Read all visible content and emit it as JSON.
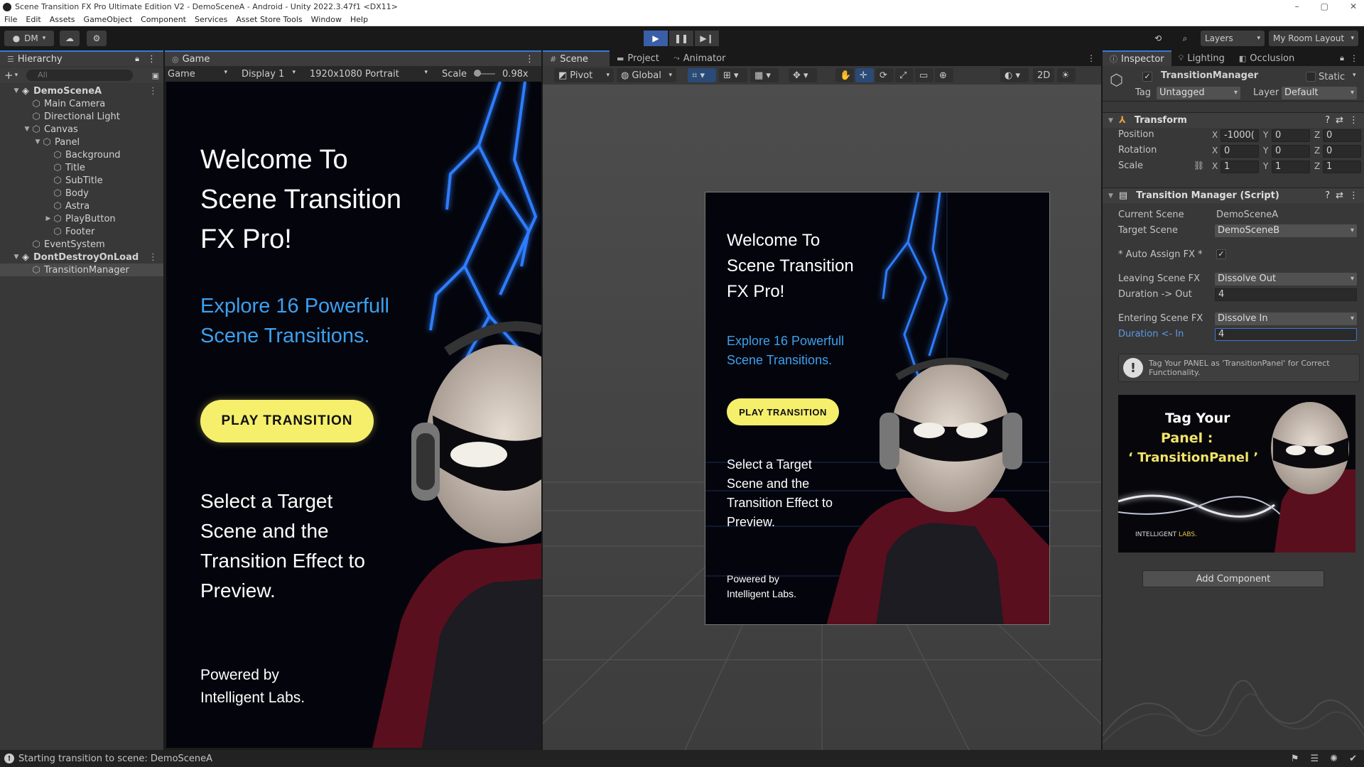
{
  "window": {
    "title": "Scene Transition FX Pro Ultimate Edition V2 - DemoSceneA - Android - Unity 2022.3.47f1 <DX11>"
  },
  "menu": [
    "File",
    "Edit",
    "Assets",
    "GameObject",
    "Component",
    "Services",
    "Asset Store Tools",
    "Window",
    "Help"
  ],
  "toolbar": {
    "account": "DM",
    "layers": "Layers",
    "layout": "My Room Layout"
  },
  "hierarchy": {
    "tab": "Hierarchy",
    "search_placeholder": "All",
    "rows": [
      {
        "label": "DemoSceneA",
        "depth": 0,
        "expanded": true,
        "scene": true
      },
      {
        "label": "Main Camera",
        "depth": 1
      },
      {
        "label": "Directional Light",
        "depth": 1
      },
      {
        "label": "Canvas",
        "depth": 1,
        "expanded": true
      },
      {
        "label": "Panel",
        "depth": 2,
        "expanded": true
      },
      {
        "label": "Background",
        "depth": 3
      },
      {
        "label": "Title",
        "depth": 3
      },
      {
        "label": "SubTitle",
        "depth": 3
      },
      {
        "label": "Body",
        "depth": 3
      },
      {
        "label": "Astra",
        "depth": 3
      },
      {
        "label": "PlayButton",
        "depth": 3,
        "collapsed": true
      },
      {
        "label": "Footer",
        "depth": 3
      },
      {
        "label": "EventSystem",
        "depth": 1
      },
      {
        "label": "DontDestroyOnLoad",
        "depth": 0,
        "expanded": true,
        "scene": true
      },
      {
        "label": "TransitionManager",
        "depth": 1,
        "selected": true
      }
    ]
  },
  "game": {
    "tab": "Game",
    "mode": "Game",
    "display": "Display 1",
    "resolution": "1920x1080 Portrait",
    "scale_label": "Scale",
    "scale_value": "0.98x",
    "title": "Welcome To\nScene Transition\nFX Pro!",
    "subtitle": "Explore 16 Powerfull\nScene Transitions.",
    "button": "PLAY TRANSITION",
    "body": "Select a Target\nScene and the\nTransition Effect to\nPreview.",
    "footer": "Powered by\nIntelligent Labs."
  },
  "scene": {
    "tabs": [
      "Scene",
      "Project",
      "Animator"
    ],
    "pivot": "Pivot",
    "global": "Global",
    "mode_2d": "2D"
  },
  "inspector": {
    "tabs": [
      "Inspector",
      "Lighting",
      "Occlusion"
    ],
    "object_name": "TransitionManager",
    "static_label": "Static",
    "tag_label": "Tag",
    "tag_value": "Untagged",
    "layer_label": "Layer",
    "layer_value": "Default",
    "transform": {
      "title": "Transform",
      "position_label": "Position",
      "rotation_label": "Rotation",
      "scale_label": "Scale",
      "position": [
        "-1000(",
        "0",
        "0"
      ],
      "rotation": [
        "0",
        "0",
        "0"
      ],
      "scale": [
        "1",
        "1",
        "1"
      ]
    },
    "script": {
      "title": "Transition Manager (Script)",
      "current_scene_label": "Current Scene",
      "current_scene_value": "DemoSceneA",
      "target_scene_label": "Target Scene",
      "target_scene_value": "DemoSceneB",
      "auto_assign_label": "* Auto Assign FX *",
      "leaving_label": "Leaving Scene FX",
      "leaving_value": "Dissolve Out",
      "duration_out_label": "Duration -> Out",
      "duration_out_value": "4",
      "entering_label": "Entering Scene FX",
      "entering_value": "Dissolve In",
      "duration_in_label": "Duration <- In",
      "duration_in_value": "4",
      "help_text": "Tag Your PANEL as 'TransitionPanel' for Correct Functionality."
    },
    "banner": {
      "line1": "Tag Your",
      "line2": "Panel :",
      "line3": "‘ TransitionPanel ’",
      "brand_a": "INTELLIGENT",
      "brand_b": "LABS."
    },
    "add_component": "Add Component"
  },
  "status": {
    "message": "Starting transition to scene: DemoSceneA"
  },
  "colors": {
    "accent_blue": "#3a79d6",
    "button_yellow": "#f5ef6c",
    "subtitle_blue": "#3ca0ef",
    "lightning": "#2f7dff"
  }
}
